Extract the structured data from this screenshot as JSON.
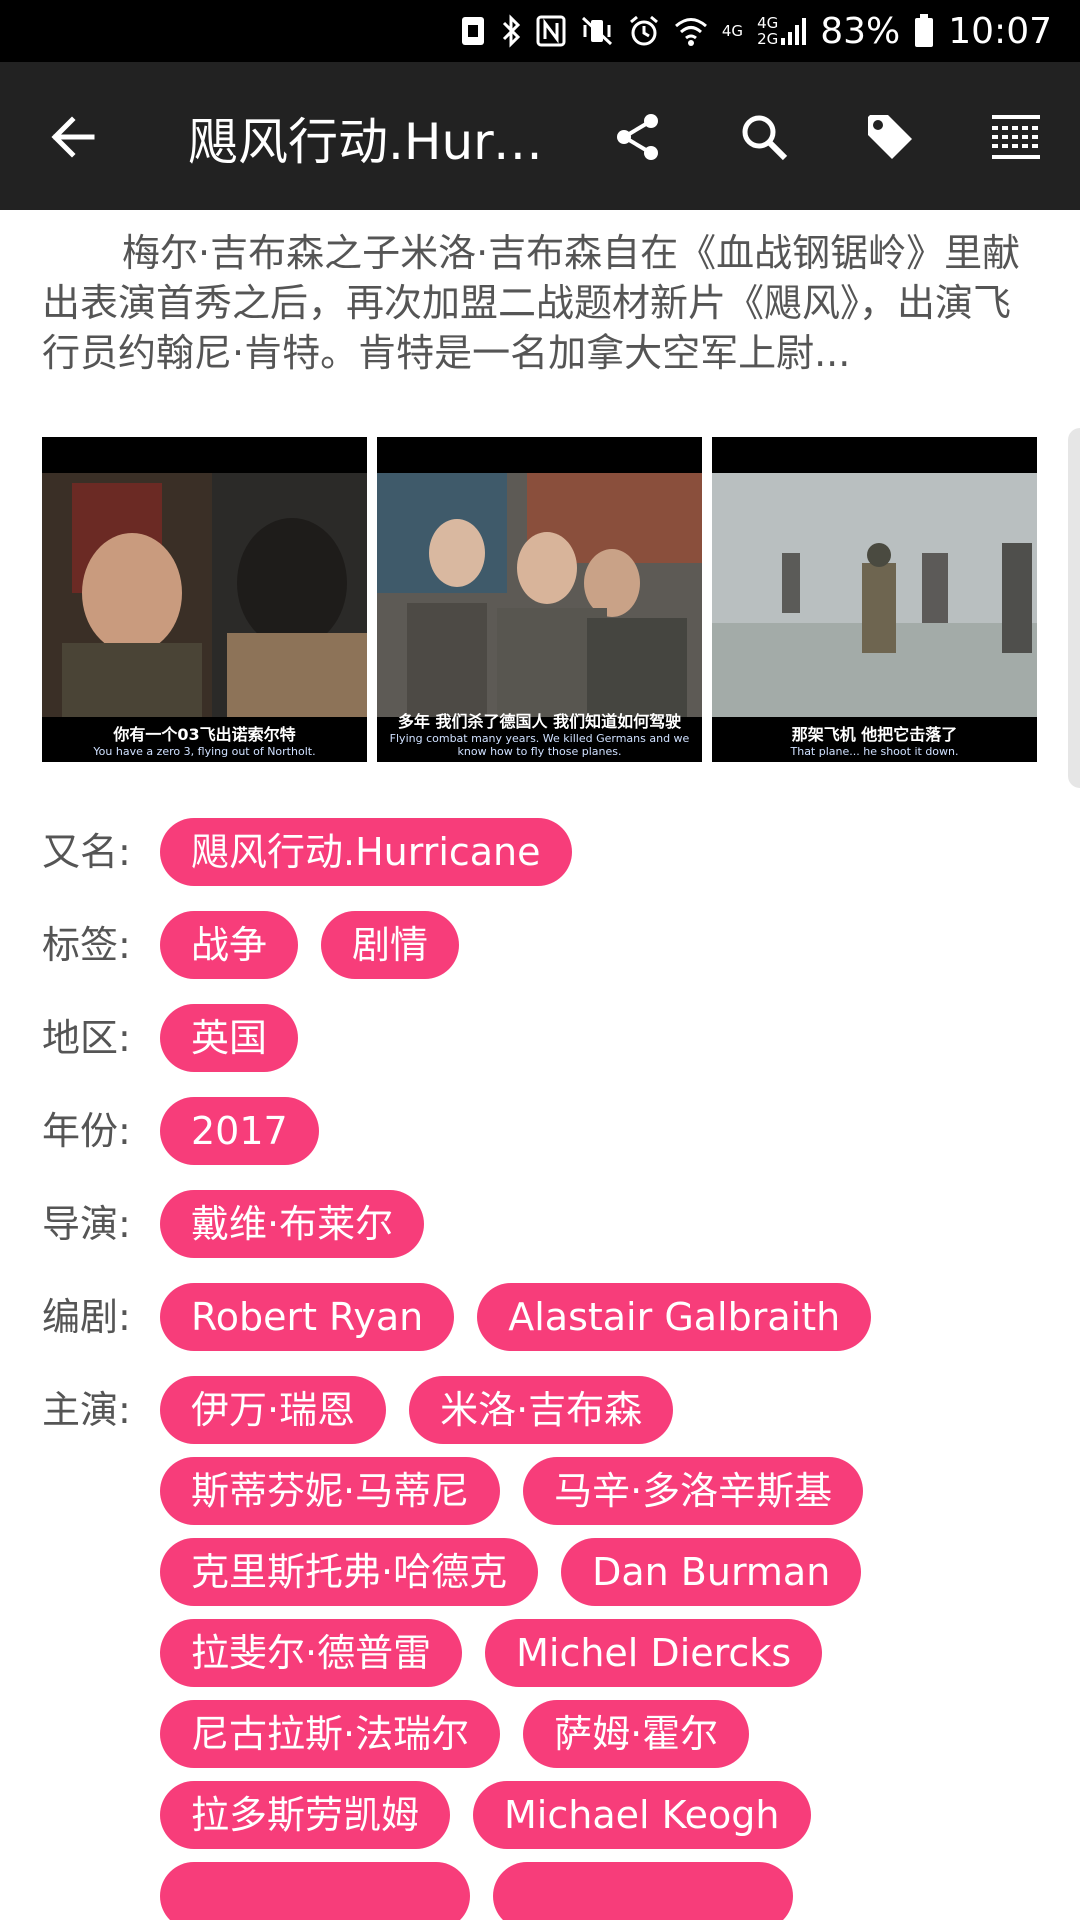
{
  "status_bar": {
    "battery": "83%",
    "time": "10:07",
    "net_4g": "4G",
    "net_4g_2g_top": "4G",
    "net_4g_2g_bottom": "2G"
  },
  "app_bar": {
    "title": "飓风行动.Hurr..."
  },
  "description": "梅尔·吉布森之子米洛·吉布森自在《血战钢锯岭》里献出表演首秀之后，再次加盟二战题材新片《飓风》，出演飞行员约翰尼·肯特。肯特是一名加拿大空军上尉...",
  "screenshots": [
    {
      "subtitle_zh": "你有一个03飞出诺索尔特",
      "subtitle_en": "You have a zero 3, flying out of Northolt."
    },
    {
      "subtitle_zh": "多年 我们杀了德国人 我们知道如何驾驶",
      "subtitle_en": "Flying combat many years. We killed Germans and we know how to fly those planes."
    },
    {
      "subtitle_zh": "那架飞机 他把它击落了",
      "subtitle_en": "That plane... he shoot it down."
    }
  ],
  "info": {
    "alias": {
      "label": "又名:",
      "values": [
        "飓风行动.Hurricane"
      ]
    },
    "tags": {
      "label": "标签:",
      "values": [
        "战争",
        "剧情"
      ]
    },
    "region": {
      "label": "地区:",
      "values": [
        "英国"
      ]
    },
    "year": {
      "label": "年份:",
      "values": [
        "2017"
      ]
    },
    "director": {
      "label": "导演:",
      "values": [
        "戴维·布莱尔"
      ]
    },
    "writer": {
      "label": "编剧:",
      "values": [
        "Robert Ryan",
        "Alastair Galbraith"
      ]
    },
    "cast": {
      "label": "主演:",
      "values": [
        "伊万·瑞恩",
        "米洛·吉布森",
        "斯蒂芬妮·马蒂尼",
        "马辛·多洛辛斯基",
        "克里斯托弗·哈德克",
        "Dan Burman",
        "拉斐尔·德普雷",
        "Michel Diercks",
        "尼古拉斯·法瑞尔",
        "萨姆·霍尔",
        "拉多斯劳凯姆",
        "Michael Keogh",
        "",
        ""
      ]
    }
  },
  "colors": {
    "chip": "#f73d7a",
    "app_bar": "#222222"
  }
}
